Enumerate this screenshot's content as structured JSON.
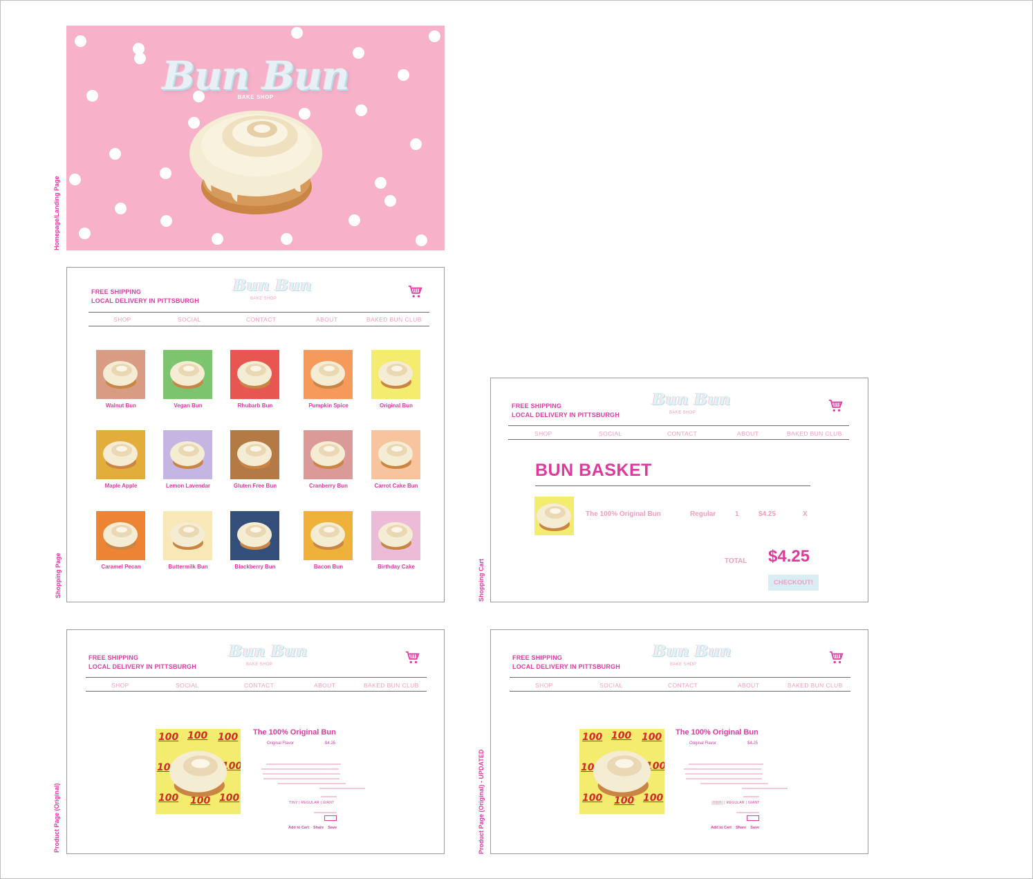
{
  "frames": {
    "landing": "Homepage/Landing Page",
    "shopping": "Shopping Page",
    "cart": "Shopping Cart",
    "product": "Product Page (Original)",
    "product_updated": "Product Page (Original) - UPDATED"
  },
  "brand": {
    "logo": "Bun Bun",
    "sub": "BAKE SHOP"
  },
  "header": {
    "promo_line1": "FREE SHIPPING",
    "promo_line2": "LOCAL DELIVERY IN PITTSBURGH"
  },
  "nav": [
    "SHOP",
    "SOCIAL",
    "CONTACT",
    "ABOUT",
    "BAKED BUN CLUB"
  ],
  "products": [
    {
      "name": "Walnut Bun",
      "bg": "#d79c82"
    },
    {
      "name": "Vegan Bun",
      "bg": "#7cc46d"
    },
    {
      "name": "Rhubarb Bun",
      "bg": "#e85652"
    },
    {
      "name": "Pumpkin Spice",
      "bg": "#f59a5a"
    },
    {
      "name": "Original Bun",
      "bg": "#f4ec6e"
    },
    {
      "name": "Maple Apple",
      "bg": "#e3ad3c"
    },
    {
      "name": "Lemon Lavendar",
      "bg": "#c5b5e2"
    },
    {
      "name": "Gluten Free Bun",
      "bg": "#b47a45"
    },
    {
      "name": "Cranberry Bun",
      "bg": "#d99a98"
    },
    {
      "name": "Carrot Cake Bun",
      "bg": "#f7c49e"
    },
    {
      "name": "Caramel Pecan",
      "bg": "#ec8433"
    },
    {
      "name": "Buttermilk Bun",
      "bg": "#f8e7b7"
    },
    {
      "name": "Blackberry Bun",
      "bg": "#34507a"
    },
    {
      "name": "Bacon Bun",
      "bg": "#eeb13a"
    },
    {
      "name": "Birthday Cake",
      "bg": "#ebbbd8"
    }
  ],
  "cart": {
    "title": "BUN BASKET",
    "item": {
      "name": "The 100% Original Bun",
      "size": "Regular",
      "qty": "1",
      "price": "$4.25",
      "remove": "X"
    },
    "total_label": "TOTAL",
    "total_value": "$4.25",
    "checkout": "CHECKOUT!"
  },
  "product": {
    "title": "The 100% Original Bun",
    "flavor": "Original Flavor",
    "price": "$4.25",
    "sizes": [
      "TINY",
      "REGULAR",
      "GIANT"
    ],
    "actions": [
      "Add to Cart",
      "Share",
      "Save"
    ],
    "badge": "100"
  },
  "colors": {
    "pink": "#e0399e",
    "light_pink": "#f49bbf",
    "landing_bg": "#f7b2c9",
    "checkout_bg": "#d8eef4"
  }
}
